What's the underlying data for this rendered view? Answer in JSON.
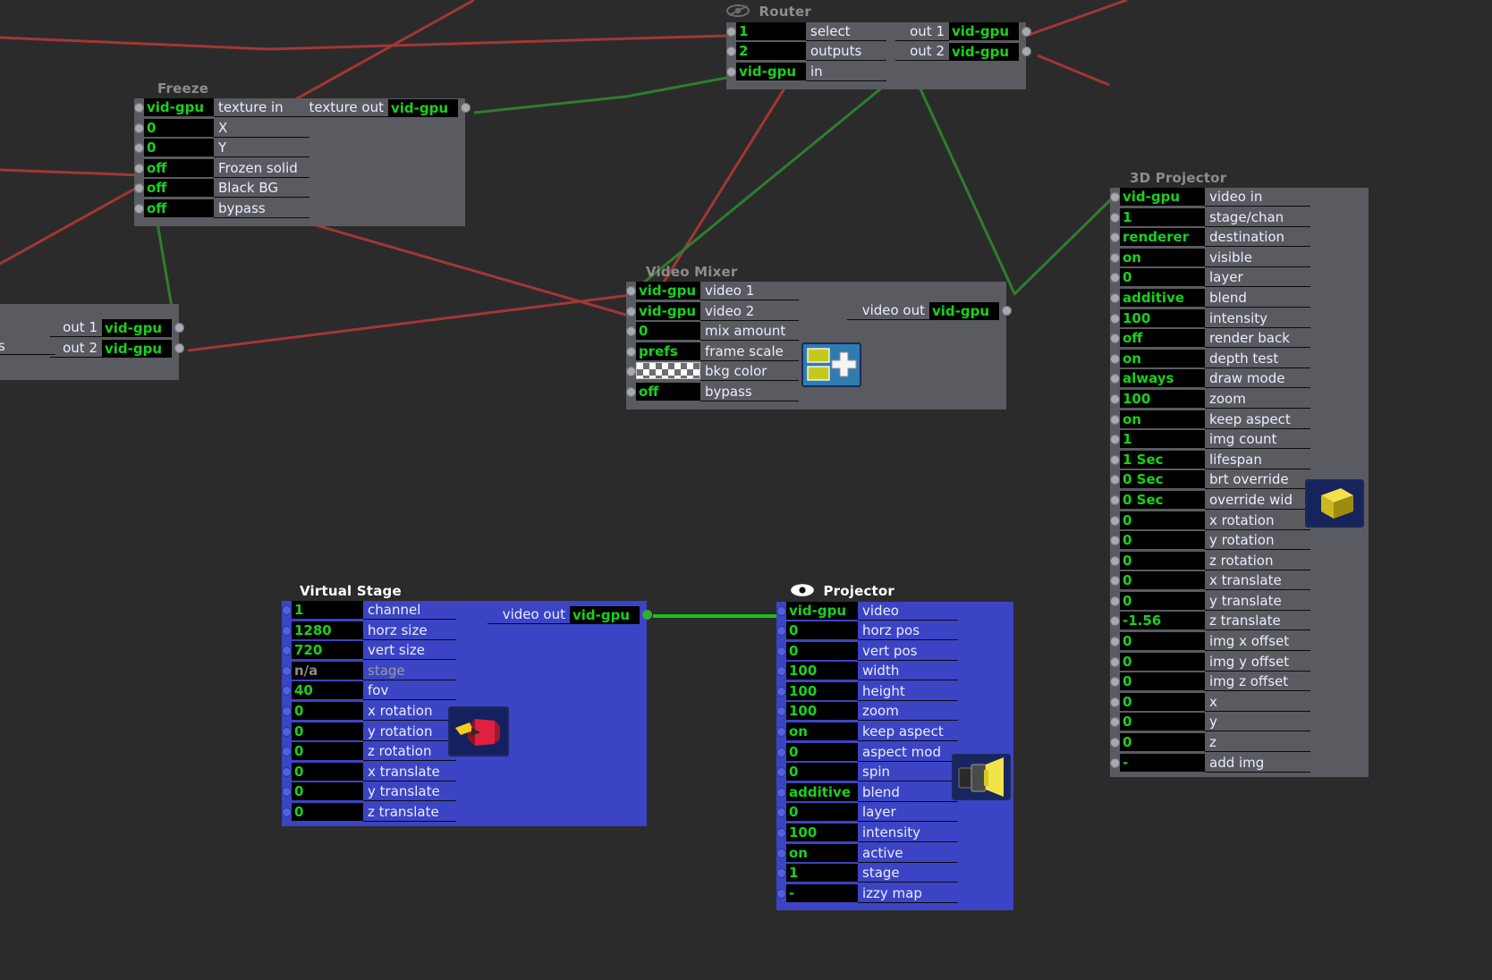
{
  "canvas": {
    "background": "#2b2b2b",
    "wire_green": "#1aa81a",
    "wire_red": "#a33636"
  },
  "nodes": [
    {
      "id": "router",
      "title": "Router",
      "icon": "eye-icon",
      "color": "grey",
      "inputs": [
        {
          "value": "1",
          "label": "select"
        },
        {
          "value": "2",
          "label": "outputs"
        },
        {
          "value": "vid-gpu",
          "label": "in"
        }
      ],
      "outputs": [
        {
          "label": "out 1",
          "value": "vid-gpu"
        },
        {
          "label": "out 2",
          "value": "vid-gpu"
        }
      ]
    },
    {
      "id": "freeze",
      "title": "Freeze",
      "color": "grey",
      "inputs": [
        {
          "value": "vid-gpu",
          "label": "texture in"
        },
        {
          "value": "0",
          "label": "X"
        },
        {
          "value": "0",
          "label": "Y"
        },
        {
          "value": "off",
          "label": "Frozen solid"
        },
        {
          "value": "off",
          "label": "Black BG"
        },
        {
          "value": "off",
          "label": "bypass"
        }
      ],
      "outputs": [
        {
          "label": "texture out",
          "value": "vid-gpu"
        }
      ]
    },
    {
      "id": "left-clipped",
      "title": "",
      "color": "grey",
      "inputs": [],
      "outputs": [
        {
          "label": "out 1",
          "value": "vid-gpu"
        },
        {
          "label": "out 2",
          "value": "vid-gpu"
        }
      ],
      "clipped_label": "ts"
    },
    {
      "id": "video-mixer",
      "title": "Video Mixer",
      "color": "grey",
      "inputs": [
        {
          "value": "vid-gpu",
          "label": "video 1"
        },
        {
          "value": "vid-gpu",
          "label": "video 2"
        },
        {
          "value": "0",
          "label": "mix amount"
        },
        {
          "value": "prefs",
          "label": "frame scale"
        },
        {
          "value": "",
          "label": "bkg color",
          "swatch": "checker"
        },
        {
          "value": "off",
          "label": "bypass"
        }
      ],
      "outputs": [
        {
          "label": "video out",
          "value": "vid-gpu"
        }
      ],
      "thumbnail": "video-mixer-thumbnail"
    },
    {
      "id": "projector-3d",
      "title": "3D Projector",
      "color": "grey",
      "inputs": [
        {
          "value": "vid-gpu",
          "label": "video in"
        },
        {
          "value": "1",
          "label": "stage/chan"
        },
        {
          "value": "renderer",
          "label": "destination"
        },
        {
          "value": "on",
          "label": "visible"
        },
        {
          "value": "0",
          "label": "layer"
        },
        {
          "value": "additive",
          "label": "blend"
        },
        {
          "value": "100",
          "label": "intensity"
        },
        {
          "value": "off",
          "label": "render back"
        },
        {
          "value": "on",
          "label": "depth test"
        },
        {
          "value": "always",
          "label": "draw mode"
        },
        {
          "value": "100",
          "label": "zoom"
        },
        {
          "value": "on",
          "label": "keep aspect"
        },
        {
          "value": "1",
          "label": "img count"
        },
        {
          "value": "1 Sec",
          "label": "lifespan"
        },
        {
          "value": "0 Sec",
          "label": "brt override"
        },
        {
          "value": "0 Sec",
          "label": "override wid"
        },
        {
          "value": "0",
          "label": "x rotation"
        },
        {
          "value": "0",
          "label": "y rotation"
        },
        {
          "value": "0",
          "label": "z rotation"
        },
        {
          "value": "0",
          "label": "x translate"
        },
        {
          "value": "0",
          "label": "y translate"
        },
        {
          "value": "-1.56",
          "label": "z translate"
        },
        {
          "value": "0",
          "label": "img x offset"
        },
        {
          "value": "0",
          "label": "img y offset"
        },
        {
          "value": "0",
          "label": "img z offset"
        },
        {
          "value": "0",
          "label": "x"
        },
        {
          "value": "0",
          "label": "y"
        },
        {
          "value": "0",
          "label": "z"
        },
        {
          "value": "-",
          "label": "add img"
        }
      ],
      "outputs": [],
      "thumbnail": "yellow-cube-thumbnail"
    },
    {
      "id": "virtual-stage",
      "title": "Virtual Stage",
      "color": "blue",
      "inputs": [
        {
          "value": "1",
          "label": "channel"
        },
        {
          "value": "1280",
          "label": "horz size"
        },
        {
          "value": "720",
          "label": "vert size"
        },
        {
          "value": "n/a",
          "label": "stage",
          "dim": true
        },
        {
          "value": "40",
          "label": "fov"
        },
        {
          "value": "0",
          "label": "x rotation"
        },
        {
          "value": "0",
          "label": "y rotation"
        },
        {
          "value": "0",
          "label": "z rotation"
        },
        {
          "value": "0",
          "label": "x translate"
        },
        {
          "value": "0",
          "label": "y translate"
        },
        {
          "value": "0",
          "label": "z translate"
        }
      ],
      "outputs": [
        {
          "label": "video out",
          "value": "vid-gpu"
        }
      ],
      "thumbnail": "red-cube-thumbnail"
    },
    {
      "id": "projector",
      "title": "Projector",
      "icon": "eye-icon",
      "color": "blue",
      "inputs": [
        {
          "value": "vid-gpu",
          "label": "video"
        },
        {
          "value": "0",
          "label": "horz pos"
        },
        {
          "value": "0",
          "label": "vert pos"
        },
        {
          "value": "100",
          "label": "width"
        },
        {
          "value": "100",
          "label": "height"
        },
        {
          "value": "100",
          "label": "zoom"
        },
        {
          "value": "on",
          "label": "keep aspect"
        },
        {
          "value": "0",
          "label": "aspect mod"
        },
        {
          "value": "0",
          "label": "spin"
        },
        {
          "value": "additive",
          "label": "blend"
        },
        {
          "value": "0",
          "label": "layer"
        },
        {
          "value": "100",
          "label": "intensity"
        },
        {
          "value": "on",
          "label": "active"
        },
        {
          "value": "1",
          "label": "stage"
        },
        {
          "value": "-",
          "label": "izzy map"
        }
      ],
      "outputs": [],
      "thumbnail": "projector-lens-thumbnail"
    }
  ]
}
